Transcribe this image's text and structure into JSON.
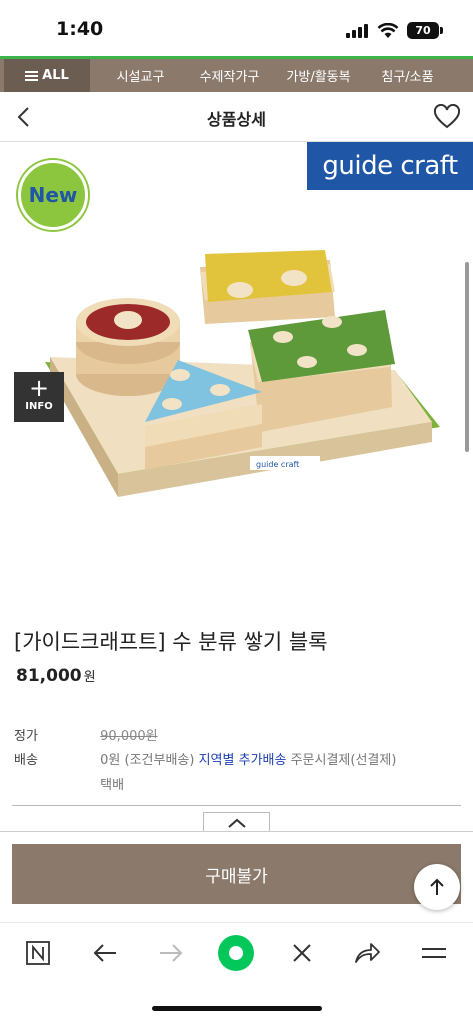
{
  "status_bar": {
    "time": "1:40",
    "battery": "70"
  },
  "category_nav": {
    "all_label": "ALL",
    "items": [
      "시설교구",
      "수제작가구",
      "가방/활동복",
      "침구/소품"
    ]
  },
  "header": {
    "title": "상품상세"
  },
  "product_image": {
    "brand_logo": "guide craft",
    "new_badge": "New",
    "info_button_label": "INFO",
    "package_label": "guide craft"
  },
  "product": {
    "name": "[가이드크래프트] 수 분류 쌓기 블록",
    "price": "81,000",
    "currency": "원",
    "list_price_label": "정가",
    "list_price": "90,000원",
    "shipping_label": "배송",
    "shipping_fee": "0원 (조건부배송)",
    "shipping_region": "지역별 추가배송",
    "shipping_payment": "주문시결제(선결제)",
    "shipping_method": "택배"
  },
  "buy_button": {
    "label": "구매불가"
  },
  "colors": {
    "brand_brown": "#8b7a6c",
    "nav_green": "#3cb44a",
    "link_blue": "#1c3fb4",
    "logo_blue": "#1f57a6",
    "toolbar_green": "#03c75a"
  },
  "toolbar": {
    "icons": [
      "naver-n-icon",
      "back-arrow-icon",
      "forward-arrow-icon",
      "naver-green-dot-icon",
      "close-icon",
      "share-icon",
      "menu-icon"
    ]
  }
}
